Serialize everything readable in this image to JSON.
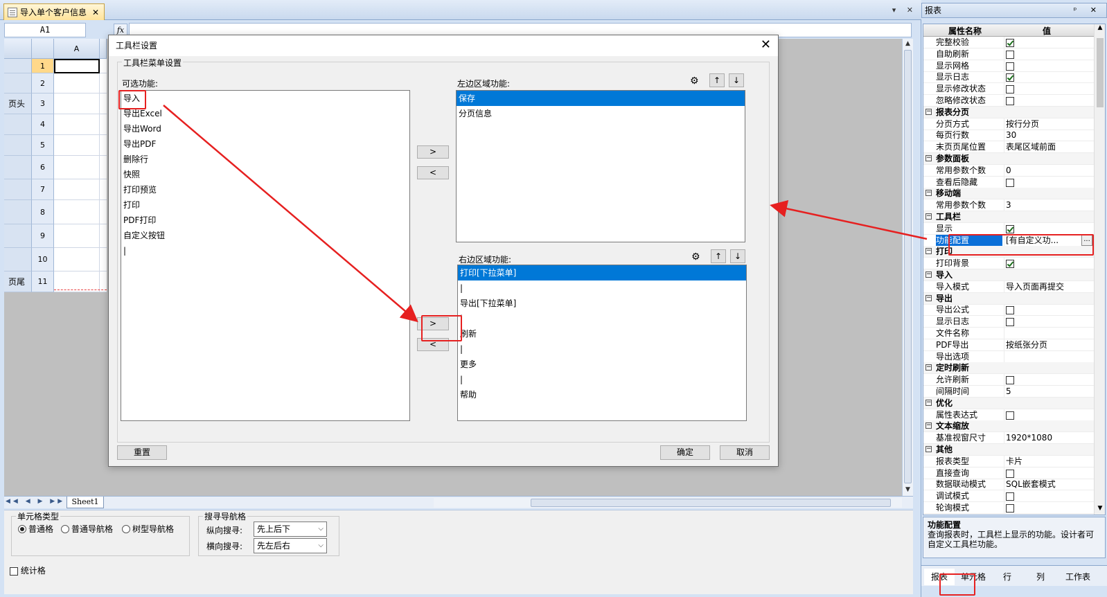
{
  "document_tab": {
    "title": "导入单个客户信息",
    "close": "✕"
  },
  "window_buttons": "▾ ✕",
  "formula_bar": {
    "cell_ref": "A1",
    "fx_label": "fx",
    "value": ""
  },
  "sheet": {
    "column_headers": [
      "A"
    ],
    "rows": [
      {
        "num": "1",
        "section": ""
      },
      {
        "num": "2",
        "section": ""
      },
      {
        "num": "3",
        "section": "页头"
      },
      {
        "num": "4",
        "section": ""
      },
      {
        "num": "5",
        "section": ""
      },
      {
        "num": "6",
        "section": ""
      },
      {
        "num": "7",
        "section": ""
      },
      {
        "num": "8",
        "section": ""
      },
      {
        "num": "9",
        "section": ""
      },
      {
        "num": "10",
        "section": ""
      },
      {
        "num": "11",
        "section": "页尾"
      }
    ],
    "tab": "Sheet1",
    "nav": "◀◀ ◀ ▶ ▶▶ +"
  },
  "bottom_panel": {
    "cell_type_group": "单元格类型",
    "cell_types": [
      "普通格",
      "普通导航格",
      "树型导航格"
    ],
    "cell_type_selected": 0,
    "nav_group": "搜寻导航格",
    "vertical_label": "纵向搜寻:",
    "vertical_value": "先上后下",
    "horizontal_label": "横向搜寻:",
    "horizontal_value": "先左后右",
    "stat_cell": "统计格"
  },
  "prop_panel": {
    "title": "报表",
    "title_buttons": "ᵖ ✕",
    "col_name": "属性名称",
    "col_value": "值",
    "desc_title": "功能配置",
    "desc_text": "查询报表时，工具栏上显示的功能。设计者可自定义工具栏功能。",
    "tabs": [
      "报表",
      "单元格",
      "行",
      "列",
      "工作表"
    ],
    "active_tab": 0,
    "rows": [
      {
        "kind": "prop",
        "name": "完整校验",
        "check": true
      },
      {
        "kind": "prop",
        "name": "自助刷新",
        "check": false
      },
      {
        "kind": "prop",
        "name": "显示网格",
        "check": false
      },
      {
        "kind": "prop",
        "name": "显示日志",
        "check": true
      },
      {
        "kind": "prop",
        "name": "显示修改状态",
        "check": false
      },
      {
        "kind": "prop",
        "name": "忽略修改状态",
        "check": false
      },
      {
        "kind": "cat",
        "name": "报表分页"
      },
      {
        "kind": "prop",
        "name": "分页方式",
        "value": "按行分页"
      },
      {
        "kind": "prop",
        "name": "每页行数",
        "value": "30"
      },
      {
        "kind": "prop",
        "name": "末页页尾位置",
        "value": "表尾区域前面"
      },
      {
        "kind": "cat",
        "name": "参数面板"
      },
      {
        "kind": "prop",
        "name": "常用参数个数",
        "value": "0"
      },
      {
        "kind": "prop",
        "name": "查看后隐藏",
        "check": false
      },
      {
        "kind": "cat",
        "name": "移动端"
      },
      {
        "kind": "prop",
        "name": "常用参数个数",
        "value": "3"
      },
      {
        "kind": "cat",
        "name": "工具栏"
      },
      {
        "kind": "prop",
        "name": "显示",
        "check": true
      },
      {
        "kind": "prop",
        "name": "功能配置",
        "value": "[有自定义功...",
        "selected": true,
        "ellipsis": "..."
      },
      {
        "kind": "cat",
        "name": "打印"
      },
      {
        "kind": "prop",
        "name": "打印背景",
        "check": true
      },
      {
        "kind": "cat",
        "name": "导入"
      },
      {
        "kind": "prop",
        "name": "导入模式",
        "value": "导入页面再提交"
      },
      {
        "kind": "cat",
        "name": "导出"
      },
      {
        "kind": "prop",
        "name": "导出公式",
        "check": false
      },
      {
        "kind": "prop",
        "name": "显示日志",
        "check": false
      },
      {
        "kind": "prop",
        "name": "文件名称",
        "value": ""
      },
      {
        "kind": "prop",
        "name": "PDF导出",
        "value": "按纸张分页"
      },
      {
        "kind": "prop",
        "name": "导出选项",
        "value": ""
      },
      {
        "kind": "cat",
        "name": "定时刷新"
      },
      {
        "kind": "prop",
        "name": "允许刷新",
        "check": false
      },
      {
        "kind": "prop",
        "name": "间隔时间",
        "value": "5"
      },
      {
        "kind": "cat",
        "name": "优化"
      },
      {
        "kind": "prop",
        "name": "属性表达式",
        "check": false
      },
      {
        "kind": "cat",
        "name": "文本缩放"
      },
      {
        "kind": "prop",
        "name": "基准视窗尺寸",
        "value": "1920*1080"
      },
      {
        "kind": "cat",
        "name": "其他"
      },
      {
        "kind": "prop",
        "name": "报表类型",
        "value": "卡片"
      },
      {
        "kind": "prop",
        "name": "直接查询",
        "check": false
      },
      {
        "kind": "prop",
        "name": "数据联动模式",
        "value": "SQL嵌套模式"
      },
      {
        "kind": "prop",
        "name": "调试模式",
        "check": false
      },
      {
        "kind": "prop",
        "name": "轮询模式",
        "check": false
      }
    ]
  },
  "dialog": {
    "title": "工具栏设置",
    "close": "✕",
    "group_title": "工具栏菜单设置",
    "available_label": "可选功能:",
    "available": [
      "导入",
      "导出Excel",
      "导出Word",
      "导出PDF",
      "删除行",
      "快照",
      "打印预览",
      "打印",
      "PDF打印",
      "自定义按钮",
      "|"
    ],
    "left_label": "左边区域功能:",
    "left_items": [
      "保存",
      "分页信息"
    ],
    "left_selected": 0,
    "right_label": "右边区域功能:",
    "right_items": [
      "打印[下拉菜单]",
      "|",
      "导出[下拉菜单]",
      "|",
      "刷新",
      "|",
      "更多",
      "|",
      "帮助"
    ],
    "right_selected": 0,
    "add_btn": ">",
    "remove_btn": "<",
    "gear": "⚙",
    "up": "↑",
    "down": "↓",
    "reset_btn": "重置",
    "ok_btn": "确定",
    "cancel_btn": "取消"
  },
  "colors": {
    "annotation": "#e62020",
    "selection": "#0078d7"
  }
}
